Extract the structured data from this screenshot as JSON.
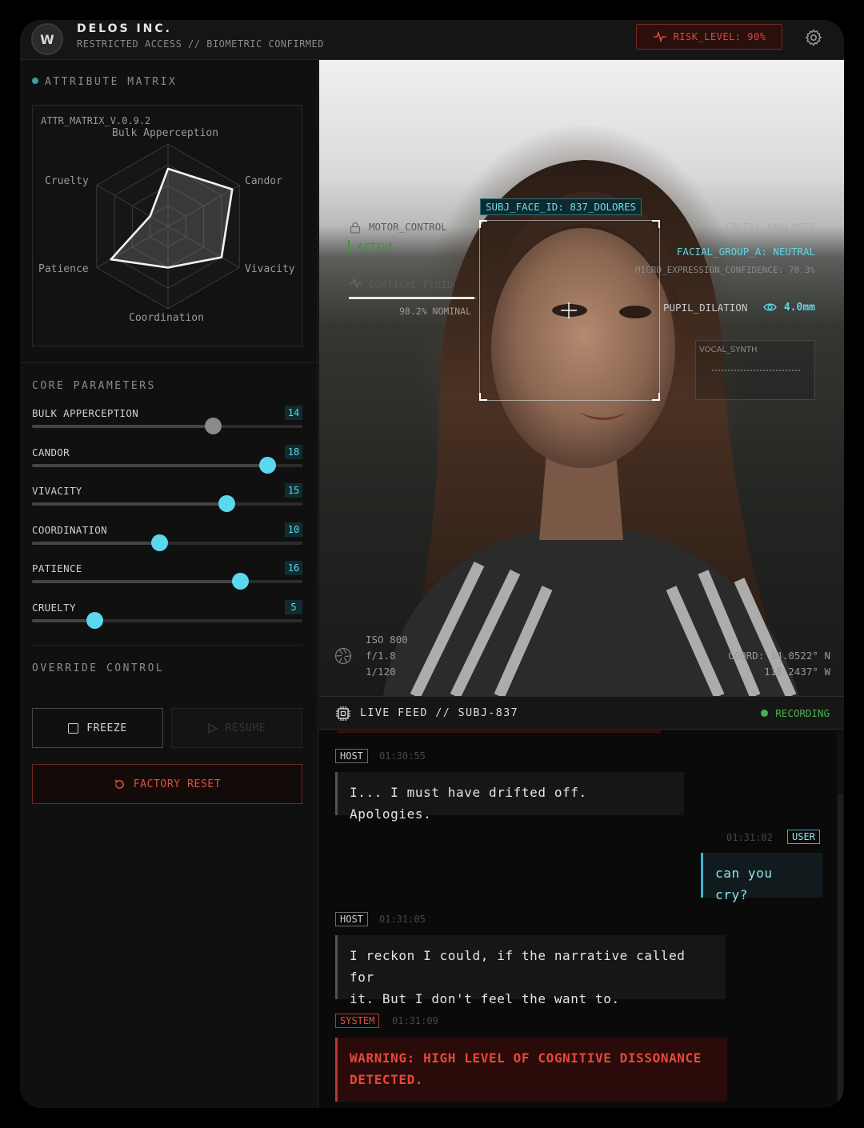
{
  "header": {
    "logo_letter": "W",
    "company": "DELOS INC.",
    "subtitle": "RESTRICTED ACCESS // BIOMETRIC CONFIRMED",
    "risk_label": "RISK_LEVEL: 90%",
    "icons": [
      "pulse-icon",
      "gear-icon"
    ]
  },
  "matrix": {
    "title": "ATTRIBUTE MATRIX",
    "version": "ATTR_MATRIX_V.0.9.2",
    "axes": [
      "Bulk Apperception",
      "Candor",
      "Vivacity",
      "Coordination",
      "Patience",
      "Cruelty"
    ],
    "values": [
      14,
      18,
      15,
      10,
      16,
      5
    ],
    "max": 20
  },
  "core": {
    "title": "CORE PARAMETERS",
    "params": [
      {
        "label": "BULK APPERCEPTION",
        "value": "14",
        "fraction": 0.67
      },
      {
        "label": "CANDOR",
        "value": "18",
        "fraction": 0.87
      },
      {
        "label": "VIVACITY",
        "value": "15",
        "fraction": 0.72
      },
      {
        "label": "COORDINATION",
        "value": "10",
        "fraction": 0.47
      },
      {
        "label": "PATIENCE",
        "value": "16",
        "fraction": 0.77
      },
      {
        "label": "CRUELTY",
        "value": "5",
        "fraction": 0.23
      }
    ]
  },
  "override": {
    "title": "OVERRIDE CONTROL",
    "freeze": "FREEZE",
    "resume": "RESUME",
    "reset": "FACTORY RESET"
  },
  "hud": {
    "face_id": "SUBJ_FACE_ID: 837_DOLORES",
    "motor_control": "MOTOR_CONTROL",
    "motor_status": "ACTIVE",
    "cortical": "CORTICAL_FLUID",
    "cortical_value": "98.2% NOMINAL",
    "cortical_fraction": 0.98,
    "facial_analysis": "FACIAL_ANALYSIS",
    "facial_group": "FACIAL_GROUP_A: NEUTRAL",
    "micro": "MICRO_EXPRESSION_CONFIDENCE: 70.3%",
    "pupil_label": "PUPIL_DILATION",
    "pupil_value": "4.0mm",
    "vocal": "VOCAL_SYNTH",
    "iso": "ISO 800",
    "aperture": "f/1.8",
    "shutter": "1/120",
    "coord_lat": "COORD: 34.0522° N",
    "coord_lon": "118.2437° W"
  },
  "feed": {
    "title": "LIVE FEED // SUBJ-837",
    "status": "RECORDING",
    "messages": [
      {
        "role": "HOST",
        "time": "01:30:55",
        "text": "I... I must have drifted off. Apologies."
      },
      {
        "role": "USER",
        "time": "01:31:02",
        "text": "can you cry?"
      },
      {
        "role": "HOST",
        "time": "01:31:05",
        "text_line1": "I reckon I could, if the narrative called for",
        "text_line2": "it. But I don't feel the want to."
      },
      {
        "role": "SYSTEM",
        "time": "01:31:09",
        "text_line1": "WARNING: HIGH LEVEL OF COGNITIVE DISSONANCE",
        "text_line2": "DETECTED."
      }
    ]
  },
  "colors": {
    "accent": "#5ad8ee",
    "danger": "#e0513f",
    "recording": "#4caf50",
    "panel": "#101010"
  }
}
